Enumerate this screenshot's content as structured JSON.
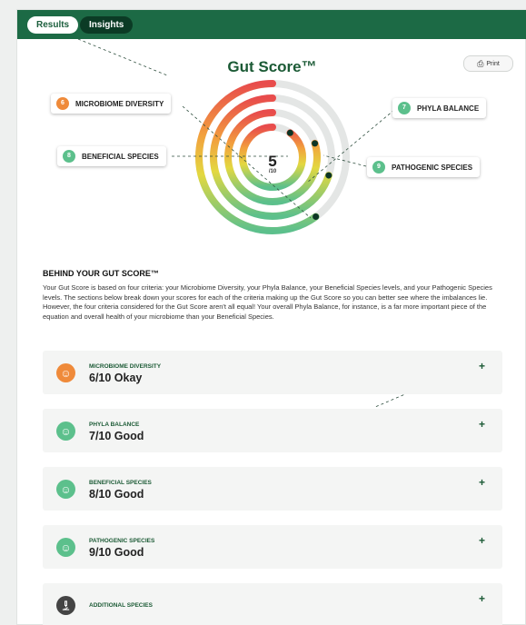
{
  "tabs": [
    {
      "label": "Results",
      "active": true
    },
    {
      "label": "Insights",
      "active": false
    }
  ],
  "title": "Gut Score™",
  "print": {
    "label": "Print",
    "icon": "printer-icon"
  },
  "score": {
    "value": "5",
    "outof": "/10"
  },
  "criteria": [
    {
      "key": "md",
      "number": "6",
      "label": "MICROBIOME DIVERSITY",
      "color": "#ef8a3a"
    },
    {
      "key": "pb",
      "number": "7",
      "label": "PHYLA BALANCE",
      "color": "#5cc08c"
    },
    {
      "key": "bs",
      "number": "8",
      "label": "BENEFICIAL SPECIES",
      "color": "#5cc08c"
    },
    {
      "key": "ps",
      "number": "9",
      "label": "PATHOGENIC SPECIES",
      "color": "#5cc08c"
    }
  ],
  "rings": [
    {
      "name": "Microbiome Diversity",
      "score": 6
    },
    {
      "name": "Phyla Balance",
      "score": 7
    },
    {
      "name": "Beneficial Species",
      "score": 8
    },
    {
      "name": "Pathogenic Species",
      "score": 9
    }
  ],
  "behind": {
    "heading": "BEHIND YOUR GUT SCORE™",
    "body": "Your Gut Score is based on four criteria: your Microbiome Diversity, your Phyla Balance, your Beneficial Species levels, and your Pathogenic Species levels. The sections below break down your scores for each of the criteria making up the Gut Score so you can better see where the imbalances lie. However, the four criteria considered for the Gut Score aren't all equal! Your overall Phyla Balance, for instance, is a far more important piece of the equation and overall health of your microbiome than your Beneficial Species."
  },
  "accordion": [
    {
      "name": "MICROBIOME DIVERSITY",
      "score": "6/10 Okay",
      "color": "#ef8a3a",
      "icon": "smile-icon"
    },
    {
      "name": "PHYLA BALANCE",
      "score": "7/10 Good",
      "color": "#5cc08c",
      "icon": "smile-icon"
    },
    {
      "name": "BENEFICIAL SPECIES",
      "score": "8/10 Good",
      "color": "#5cc08c",
      "icon": "smile-icon"
    },
    {
      "name": "PATHOGENIC SPECIES",
      "score": "9/10 Good",
      "color": "#5cc08c",
      "icon": "smile-icon"
    },
    {
      "name": "ADDITIONAL SPECIES",
      "score": "",
      "color": "#444444",
      "icon": "microscope-icon"
    }
  ],
  "plus_symbol": "+",
  "colors": {
    "brand": "#1c6a45",
    "brand_dark": "#0b3b25",
    "okay": "#ef8a3a",
    "good": "#5cc08c"
  }
}
